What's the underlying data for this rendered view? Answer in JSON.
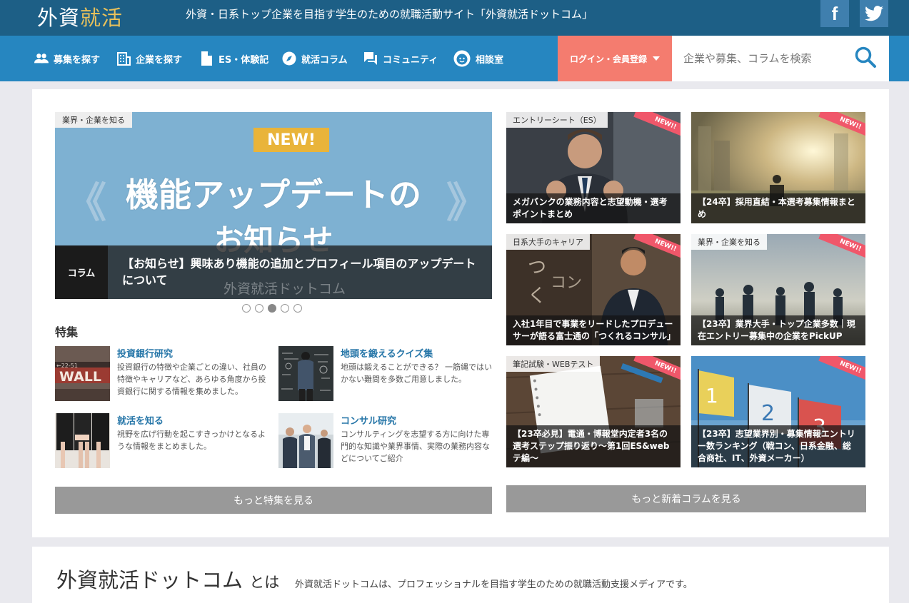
{
  "header": {
    "logo_main": "外資",
    "logo_accent": "就活",
    "tagline": "外資・日系トップ企業を目指す学生のための就職活動サイト「外資就活ドットコム」",
    "facebook_label": "f"
  },
  "nav": {
    "items": [
      {
        "label": "募集を探す",
        "icon": "people-icon"
      },
      {
        "label": "企業を探す",
        "icon": "building-icon"
      },
      {
        "label": "ES・体験記",
        "icon": "document-icon"
      },
      {
        "label": "就活コラム",
        "icon": "compass-icon"
      },
      {
        "label": "コミュニティ",
        "icon": "chat-icon"
      },
      {
        "label": "相談室",
        "icon": "face-icon"
      }
    ],
    "login_label": "ログイン・会員登録",
    "search_placeholder": "企業や募集、コラムを検索"
  },
  "slider": {
    "category": "業界・企業を知る",
    "badge": "NEW!",
    "headline_1": "機能アップデートの",
    "headline_2": "お知らせ",
    "caption_tag": "コラム",
    "caption_title": "【お知らせ】興味あり機能の追加とプロフィール項目のアップデートについて",
    "watermark": "外資就活ドットコム",
    "chevron_left": "《",
    "chevron_right": "》",
    "active_dot": 3,
    "dot_count": 5
  },
  "features": {
    "heading": "特集",
    "items": [
      {
        "title": "投資銀行研究",
        "desc": "投資銀行の特徴や企業ごとの違い、社員の特徴やキャリアなど、あらゆる角度から投資銀行に関する情報を集めました。"
      },
      {
        "title": "地頭を鍛えるクイズ集",
        "desc": "地頭は鍛えることができる？ 一筋縄ではいかない難問を多数ご用意しました。"
      },
      {
        "title": "就活を知る",
        "desc": "視野を広げ行動を起こすきっかけとなるような情報をまとめました。"
      },
      {
        "title": "コンサル研究",
        "desc": "コンサルティングを志望する方に向けた専門的な知識や業界事情、実際の業務内容などについてご紹介"
      }
    ],
    "more_label": "もっと特集を見る"
  },
  "columns": {
    "ribbon": "NEW!!",
    "items": [
      {
        "category": "エントリーシート（ES）",
        "title": "メガバンクの業務内容と志望動機・選考ポイントまとめ"
      },
      {
        "category": "",
        "title": "【24卒】採用直結・本選考募集情報まとめ"
      },
      {
        "category": "日系大手のキャリア",
        "title": "入社1年目で事業をリードしたプロデューサーが語る富士通の「つくれるコンサル」"
      },
      {
        "category": "業界・企業を知る",
        "title": "【23卒】業界大手・トップ企業多数｜現在エントリー募集中の企業をPickUP"
      },
      {
        "category": "筆記試験・WEBテスト",
        "title": "【23卒必見】電通・博報堂内定者3名の選考ステップ振り返り〜第1回ES&webテ編〜"
      },
      {
        "category": "",
        "title": "【23卒】志望業界別・募集情報エントリー数ランキング（戦コン、日系金融、総合商社、IT、外資メーカー）"
      }
    ],
    "more_label": "もっと新着コラムを見る"
  },
  "about": {
    "title": "外資就活ドットコム",
    "title_suffix": "とは",
    "text": "外資就活ドットコムは、プロフェッショナルを目指す学生のための就職活動支援メディアです。"
  },
  "colors": {
    "header_dark": "#1d5f86",
    "nav_blue": "#2686c0",
    "login_coral": "#f47c6f",
    "link_blue": "#2676a8",
    "ribbon_red": "#f0576a"
  }
}
